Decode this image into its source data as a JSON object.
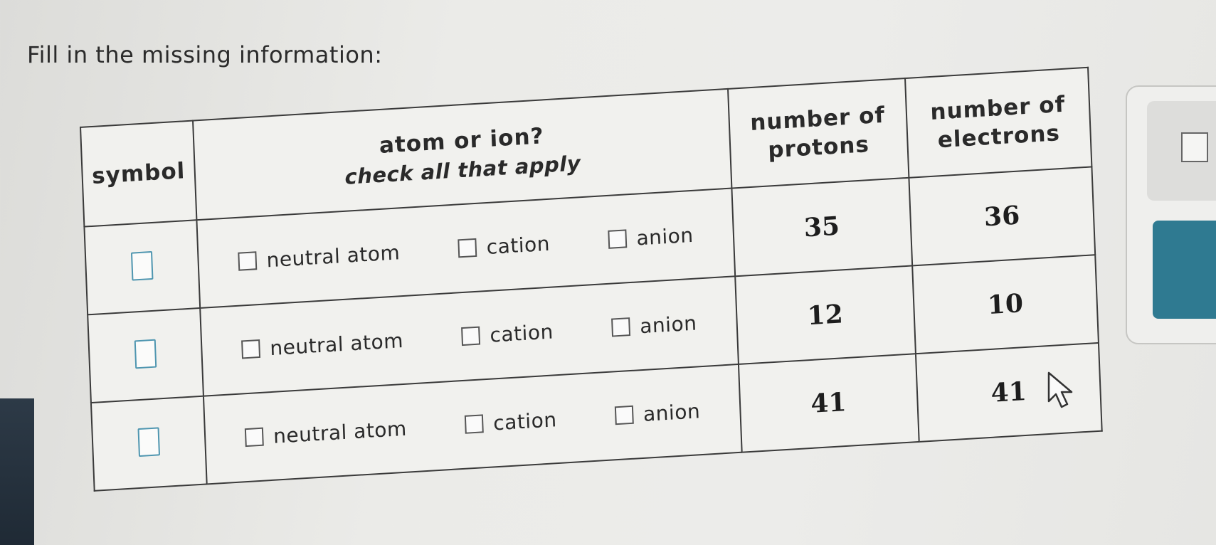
{
  "prompt": "Fill in the missing information:",
  "table": {
    "headers": {
      "symbol": "symbol",
      "atom_or_ion": "atom or ion?",
      "atom_or_ion_sub": "check all that apply",
      "protons_line1": "number of",
      "protons_line2": "protons",
      "electrons_line1": "number of",
      "electrons_line2": "electrons"
    },
    "options": [
      "neutral atom",
      "cation",
      "anion"
    ],
    "rows": [
      {
        "protons": "35",
        "electrons": "36"
      },
      {
        "protons": "12",
        "electrons": "10"
      },
      {
        "protons": "41",
        "electrons": "41"
      }
    ]
  },
  "colors": {
    "accent": "#2f7a91",
    "symbol_box_border": "#4f96b0"
  }
}
